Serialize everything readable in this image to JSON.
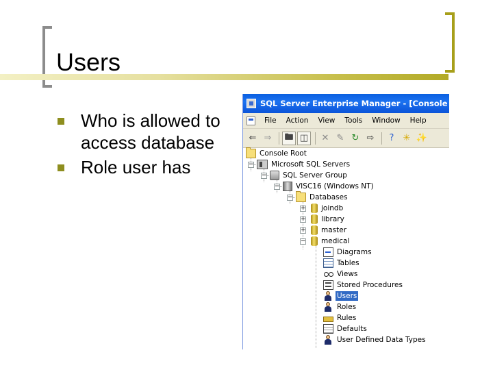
{
  "slide": {
    "title": "Users",
    "bullets": [
      "Who is allowed to access database",
      "Role user has"
    ]
  },
  "window": {
    "title": "SQL Server Enterprise Manager - [Console Root",
    "menu": [
      "File",
      "Action",
      "View",
      "Tools",
      "Window",
      "Help"
    ],
    "toolbar_icons": [
      "back-arrow-icon",
      "forward-arrow-icon",
      "up-folder-icon",
      "show-hide-tree-icon",
      "delete-icon",
      "properties-icon",
      "refresh-icon",
      "export-icon",
      "help-icon",
      "wizard-icon",
      "new-icon"
    ],
    "tree": {
      "console_root": "Console Root",
      "servers": "Microsoft SQL Servers",
      "group": "SQL Server Group",
      "server": "VISC16 (Windows NT)",
      "databases": "Databases",
      "db_items": [
        "joindb",
        "library",
        "master",
        "medical"
      ],
      "medical_items": [
        "Diagrams",
        "Tables",
        "Views",
        "Stored Procedures",
        "Users",
        "Roles",
        "Rules",
        "Defaults",
        "User Defined Data Types"
      ],
      "selected": "Users"
    }
  },
  "colors": {
    "accent_olive": "#a79f1a",
    "titlebar_blue": "#0a5fe0",
    "selection_blue": "#316ac5"
  }
}
